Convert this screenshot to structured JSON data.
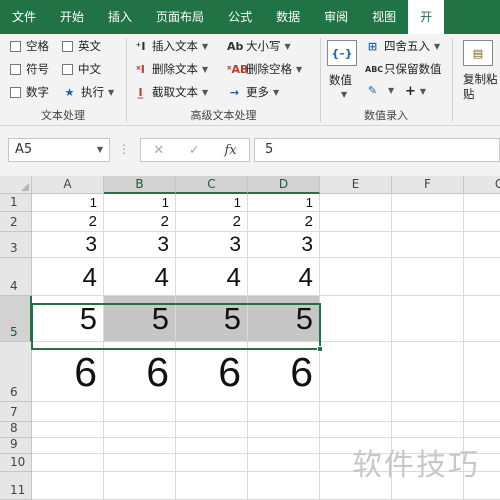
{
  "tabs": [
    "文件",
    "开始",
    "插入",
    "页面布局",
    "公式",
    "数据",
    "审阅",
    "视图",
    "开"
  ],
  "ribbon": {
    "group1": {
      "label": "文本处理",
      "checkboxes": [
        "空格",
        "英文",
        "符号",
        "中文",
        "数字",
        "执行"
      ]
    },
    "group2": {
      "label": "高级文本处理",
      "col1": [
        "插入文本",
        "删除文本",
        "截取文本"
      ],
      "col2": [
        "大小写",
        "删除空格",
        "更多"
      ]
    },
    "group3": {
      "label": "数值录入",
      "big_button": "数值",
      "items": [
        "四舍五入",
        "只保留数值"
      ],
      "plus": "+"
    },
    "group4": {
      "big_button": "复制粘\n贴"
    }
  },
  "formula_bar": {
    "name_box": "A5",
    "cancel": "✕",
    "enter": "✓",
    "fx": "fx",
    "value": "5"
  },
  "columns": [
    "A",
    "B",
    "C",
    "D",
    "E",
    "F",
    "G"
  ],
  "rows": [
    "1",
    "2",
    "3",
    "4",
    "5",
    "6",
    "7",
    "8",
    "9",
    "10",
    "11"
  ],
  "cells": [
    [
      "1",
      "1",
      "1",
      "1"
    ],
    [
      "2",
      "2",
      "2",
      "2"
    ],
    [
      "3",
      "3",
      "3",
      "3"
    ],
    [
      "4",
      "4",
      "4",
      "4"
    ],
    [
      "5",
      "5",
      "5",
      "5"
    ],
    [
      "6",
      "6",
      "6",
      "6"
    ]
  ],
  "watermark": "软件技巧",
  "colors": {
    "accent": "#217346",
    "selection_fill": "#c6c6c6"
  }
}
